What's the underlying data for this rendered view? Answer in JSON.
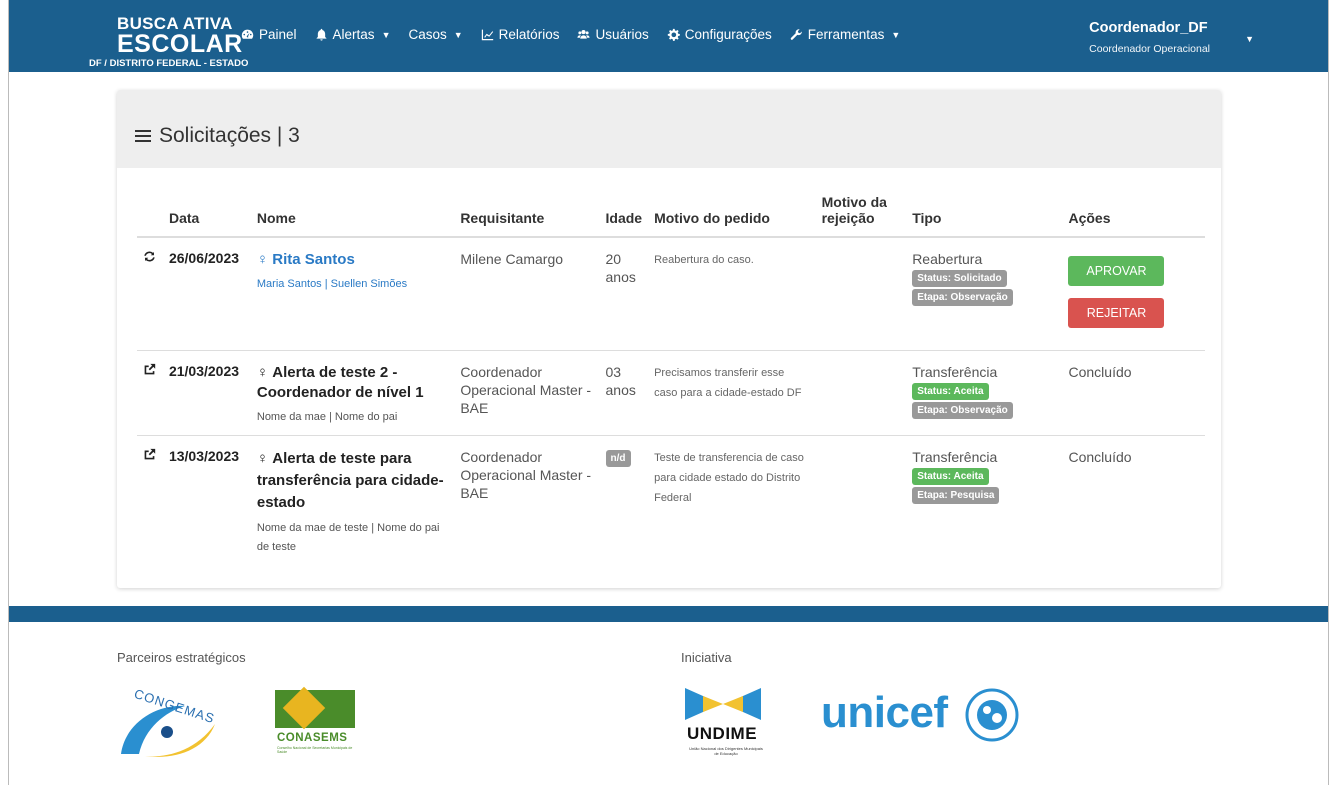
{
  "brand": {
    "line1": "BUSCA ATIVA",
    "line2": "ESCOLAR",
    "line3": "DF / DISTRITO FEDERAL - ESTADO"
  },
  "nav": [
    {
      "label": "Painel",
      "icon": "dashboard-icon",
      "caret": false
    },
    {
      "label": "Alertas",
      "icon": "bell-icon",
      "caret": true
    },
    {
      "label": "Casos",
      "icon": "",
      "caret": true
    },
    {
      "label": "Relatórios",
      "icon": "line-chart-icon",
      "caret": false
    },
    {
      "label": "Usuários",
      "icon": "users-icon",
      "caret": false
    },
    {
      "label": "Configurações",
      "icon": "gear-icon",
      "caret": false
    },
    {
      "label": "Ferramentas",
      "icon": "wrench-icon",
      "caret": true
    }
  ],
  "user": {
    "name": "Coordenador_DF",
    "role": "Coordenador Operacional"
  },
  "panel": {
    "title": "Solicitações | 3"
  },
  "table": {
    "headers": {
      "date": "Data",
      "name": "Nome",
      "requester": "Requisitante",
      "age": "Idade",
      "reason": "Motivo do pedido",
      "rejection": "Motivo da rejeição",
      "type": "Tipo",
      "actions": "Ações"
    },
    "rows": [
      {
        "icon": "refresh-icon",
        "date": "26/06/2023",
        "name": "Rita Santos",
        "parents": "Maria Santos | Suellen Simões",
        "requester": "Milene Camargo",
        "age": "20 anos",
        "reason": "Reabertura do caso.",
        "rejection": "",
        "type": "Reabertura",
        "status": "Status: Solicitado",
        "stage": "Etapa: Observação",
        "approve": "APROVAR",
        "reject": "REJEITAR",
        "concluded": ""
      },
      {
        "icon": "share-icon",
        "date": "21/03/2023",
        "name": "Alerta de teste 2 - Coordenador de nível 1",
        "parents": "Nome da mae | Nome do pai",
        "requester": "Coordenador Operacional Master - BAE",
        "age": "03 anos",
        "reason": "Precisamos transferir esse caso para a cidade-estado DF",
        "rejection": "",
        "type": "Transferência",
        "status": "Status: Aceita",
        "stage": "Etapa: Observação",
        "concluded": "Concluído"
      },
      {
        "icon": "share-icon",
        "date": "13/03/2023",
        "name": "Alerta de teste para transferência para cidade-estado",
        "parents": "Nome da mae de teste | Nome do pai de teste",
        "requester": "Coordenador Operacional Master - BAE",
        "age": "n/d",
        "reason": "Teste de transferencia de caso para cidade estado do Distrito Federal",
        "rejection": "",
        "type": "Transferência",
        "status": "Status: Aceita",
        "stage": "Etapa: Pesquisa",
        "concluded": "Concluído"
      }
    ]
  },
  "footer": {
    "partners_label": "Parceiros estratégicos",
    "initiative_label": "Iniciativa",
    "logos": {
      "congemas": "CONGEMAS",
      "conasems": "CONASEMS",
      "conasems_sub": "Conselho Nacional de Secretarias Municipais de Saúde",
      "undime": "UNDIME",
      "undime_sub": "União Nacional dos Dirigentes Municipais de Educação",
      "unicef": "unicef"
    }
  },
  "colors": {
    "brand_blue": "#1b5f8e",
    "link_blue": "#2a7ac5",
    "success": "#5cb85c",
    "danger": "#d9534f",
    "badge_gray": "#999999"
  }
}
